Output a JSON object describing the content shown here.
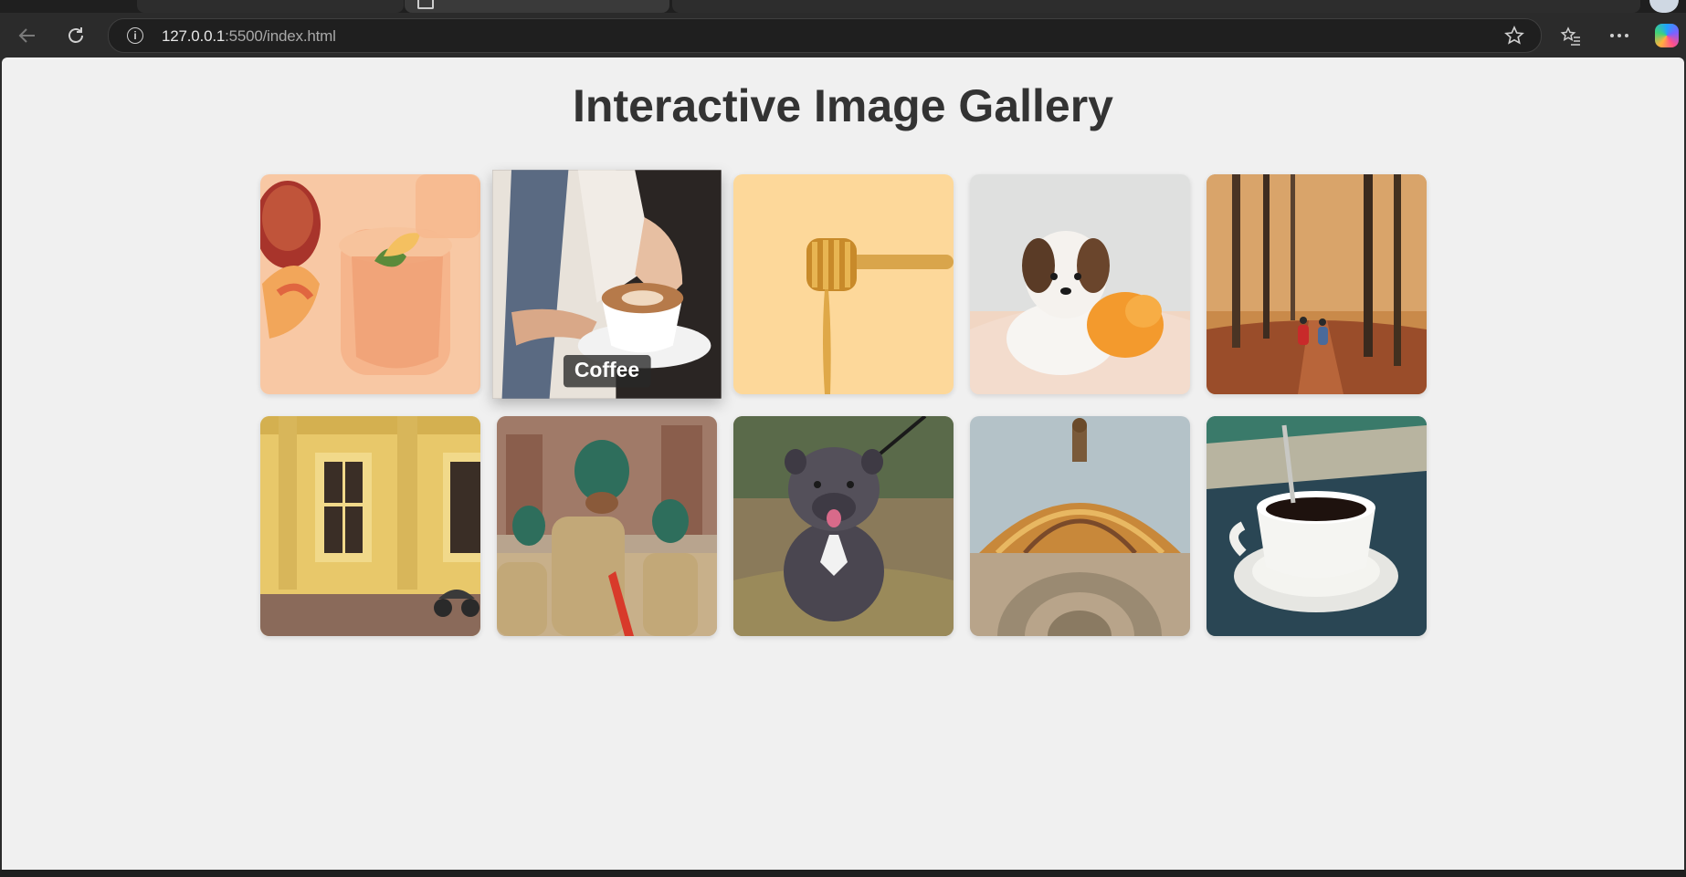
{
  "browser": {
    "url_host": "127.0.0.1",
    "url_path": ":5500/index.html"
  },
  "page": {
    "title": "Interactive Image Gallery"
  },
  "gallery": {
    "items": [
      {
        "subject": "peach drink",
        "caption": ""
      },
      {
        "subject": "coffee",
        "caption": "Coffee"
      },
      {
        "subject": "honey dipper",
        "caption": ""
      },
      {
        "subject": "puppy",
        "caption": ""
      },
      {
        "subject": "autumn forest path",
        "caption": ""
      },
      {
        "subject": "yellow building",
        "caption": ""
      },
      {
        "subject": "marching guards",
        "caption": ""
      },
      {
        "subject": "bulldog",
        "caption": ""
      },
      {
        "subject": "ornate dome",
        "caption": ""
      },
      {
        "subject": "espresso cup",
        "caption": ""
      }
    ],
    "hovered_index": 1
  }
}
